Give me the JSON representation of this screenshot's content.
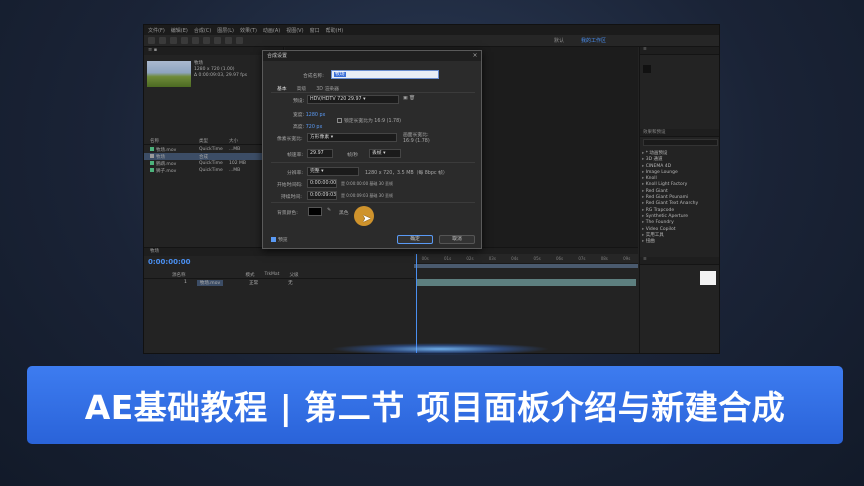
{
  "menubar": {
    "items": [
      "文件(F)",
      "编辑(E)",
      "合成(C)",
      "图层(L)",
      "效果(T)",
      "动画(A)",
      "视图(V)",
      "窗口",
      "帮助(H)"
    ]
  },
  "workspaces": {
    "default_label": "默认",
    "active_label": "我的工作区"
  },
  "project": {
    "thumb_name": "牧场",
    "thumb_dims": "1280 x 720 (1.00)",
    "thumb_dur": "Δ 0:00:09:03, 29.97 fps",
    "columns": {
      "name": "名称",
      "type": "类型",
      "size": "大小"
    },
    "rows": [
      {
        "name": "牧场.mov",
        "type": "QuickTime",
        "size": "...MB",
        "selected": false
      },
      {
        "name": "牧场",
        "type": "合成",
        "size": "",
        "selected": true
      },
      {
        "name": "鹦鹉.mov",
        "type": "QuickTime",
        "size": "102 MB",
        "selected": false
      },
      {
        "name": "狮子.mov",
        "type": "QuickTime",
        "size": "...MB",
        "selected": false
      }
    ],
    "bpc": "8 bpc"
  },
  "timeline": {
    "timecode": "0:00:00:00",
    "tab_label": "牧场",
    "col_source": "源名称",
    "col_mode": "模式",
    "col_trkmat": "TrkMat",
    "col_parent": "父级",
    "layer_index": "1",
    "layer_name": "牧场.mov",
    "layer_mode": "正常",
    "layer_parent": "无",
    "ruler_ticks": [
      "00s",
      "01s",
      "02s",
      "03s",
      "04s",
      "05s",
      "06s",
      "07s",
      "08s",
      "09s"
    ]
  },
  "effects": {
    "panel_title": "效果和预设",
    "items": [
      "* 动画预设",
      "3D 通道",
      "CINEMA 4D",
      "Image Lounge",
      "Knoll",
      "Knoll Light Factory",
      "Red Giant",
      "Red Giant Psunami",
      "Red Giant Text Anarchy",
      "RG Trapcode",
      "Synthetic Aperture",
      "The Foundry",
      "Video Copilot",
      "实用工具",
      "扭曲"
    ]
  },
  "dialog": {
    "title": "合成设置",
    "name_label": "合成名称:",
    "name_value": "牧场",
    "tabs": [
      "基本",
      "高级",
      "3D 渲染器"
    ],
    "preset_label": "预设:",
    "preset_value": "HDV/HDTV 720 29.97",
    "width_label": "宽度:",
    "width_value": "1280 px",
    "height_label": "高度:",
    "height_value": "720 px",
    "lock_label": "锁定长宽比为 16:9 (1.78)",
    "pixel_aspect_label": "像素长宽比:",
    "pixel_aspect_value": "方形像素",
    "frame_aspect_label": "画面长宽比:",
    "frame_aspect_value": "16:9 (1.78)",
    "framerate_label": "帧速率:",
    "framerate_value": "29.97",
    "framerate_unit": "帧/秒",
    "drop_frame": "丢帧",
    "resolution_label": "分辨率:",
    "resolution_value": "完整",
    "resolution_info": "1280 x 720，3.5 MB（每 8bpc 帧）",
    "start_tc_label": "开始时间码:",
    "start_tc_value": "0:00:00:00",
    "start_tc_info": "是 0:00:00:00 基础 30 丢帧",
    "duration_label": "持续时间:",
    "duration_value": "0:00:09:03",
    "duration_info": "是 0:00:09:03 基础 30 丢帧",
    "bgcolor_label": "背景颜色:",
    "bgcolor_name": "黑色",
    "preview_label": "预览",
    "ok_label": "确定",
    "cancel_label": "取消"
  },
  "banner": {
    "text": "AE基础教程 | 第二节 项目面板介绍与新建合成"
  },
  "colors": {
    "accent": "#4a8ff0",
    "banner": "#2f6be0",
    "cursor_highlight": "#eca62d"
  }
}
